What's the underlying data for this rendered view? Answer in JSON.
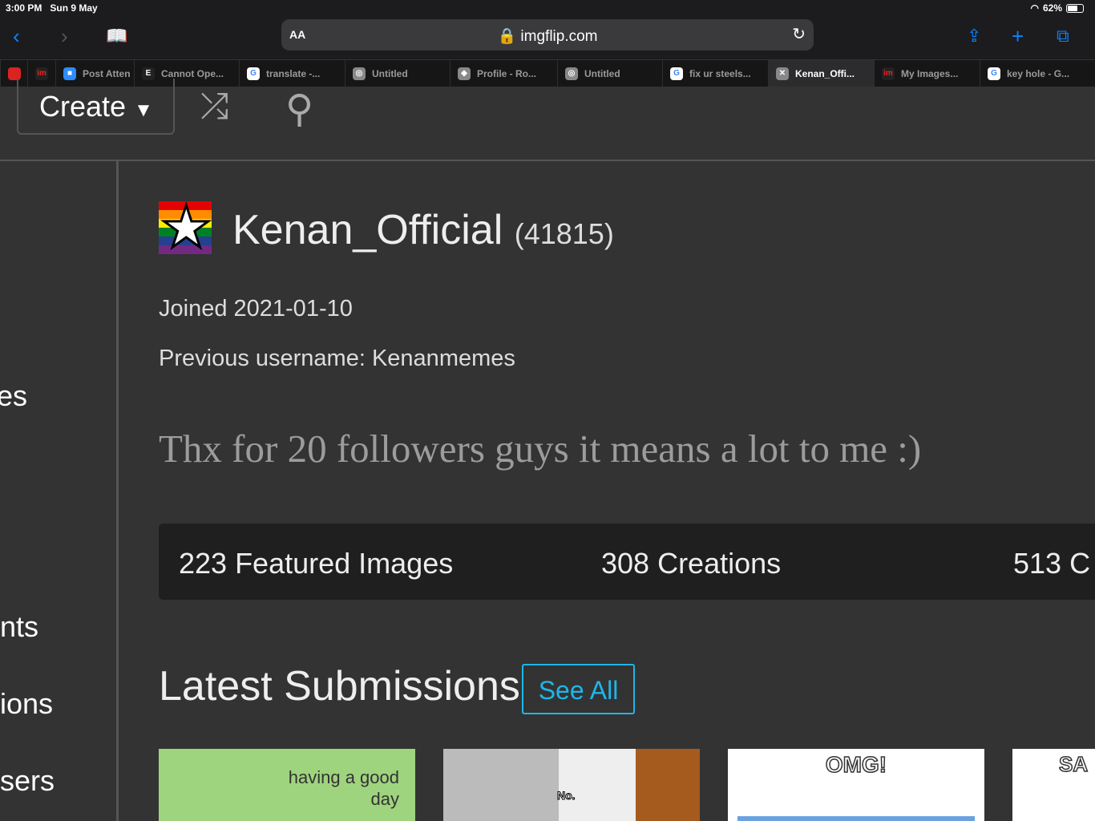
{
  "status": {
    "time": "3:00 PM",
    "date": "Sun 9 May",
    "battery": "62%",
    "battery_level": 0.62
  },
  "browser": {
    "aa": "AA",
    "url": "imgflip.com",
    "tabs": [
      {
        "label": "",
        "icon": "red-icon"
      },
      {
        "label": "",
        "icon": "imgflip-icon"
      },
      {
        "label": "Post Atten",
        "icon": "zoom-icon"
      },
      {
        "label": "Cannot Ope...",
        "icon": "e-icon"
      },
      {
        "label": "translate -...",
        "icon": "google-icon"
      },
      {
        "label": "Untitled",
        "icon": "compass-icon"
      },
      {
        "label": "Profile - Ro...",
        "icon": "roblox-icon"
      },
      {
        "label": "Untitled",
        "icon": "compass-icon"
      },
      {
        "label": "fix ur steels...",
        "icon": "google-icon"
      },
      {
        "label": "Kenan_Offi...",
        "icon": "close-icon",
        "active": true
      },
      {
        "label": "My Images...",
        "icon": "imgflip-icon"
      },
      {
        "label": "key hole - G...",
        "icon": "google-icon"
      }
    ]
  },
  "nav": {
    "create": "Create"
  },
  "sidebar": {
    "items": [
      "es",
      "nts",
      "ions",
      "sers"
    ]
  },
  "profile": {
    "username": "Kenan_Official",
    "points": "(41815)",
    "joined": "Joined 2021-01-10",
    "previous": "Previous username: Kenanmemes",
    "bio": "Thx for 20 followers guys it means a lot to me :)",
    "stats": [
      "223 Featured Images",
      "308 Creations",
      "513 C"
    ]
  },
  "latest": {
    "title": "Latest Submissions",
    "see_all": "See All",
    "thumbs": [
      {
        "text": "having a good day"
      },
      {
        "text": "No."
      },
      {
        "text": "OMG!"
      },
      {
        "text": "SA"
      }
    ]
  }
}
